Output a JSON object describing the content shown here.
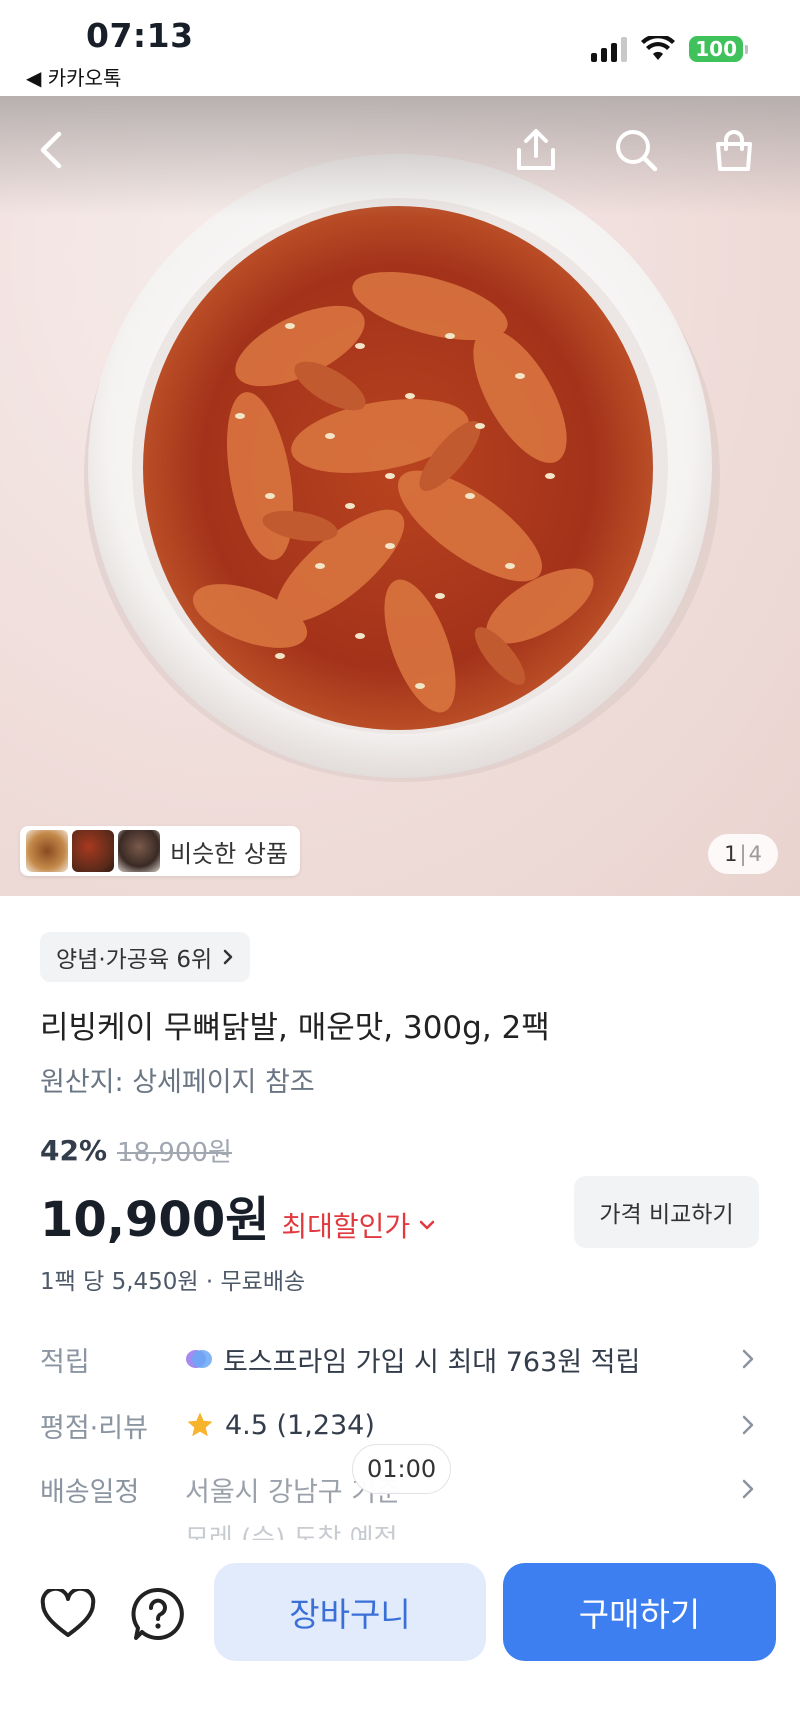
{
  "status": {
    "time": "07:13",
    "back_app": "◀ 카카오톡",
    "battery": "100"
  },
  "gallery": {
    "current": "1",
    "separator": "|",
    "total": "4",
    "similar_label": "비슷한 상품"
  },
  "product": {
    "rank_label": "양념·가공육 6위",
    "title": "리빙케이 무뼈닭발, 매운맛, 300g, 2팩",
    "origin": "원산지: 상세페이지 참조",
    "discount_pct": "42%",
    "original_price": "18,900원",
    "price": "10,900원",
    "max_discount_label": "최대할인가",
    "compare_label": "가격 비교하기",
    "per_pack": "1팩 당 5,450원 · 무료배송"
  },
  "info_rows": {
    "points": {
      "label": "적립",
      "value": "토스프라임 가입 시 최대 763원 적립"
    },
    "rating": {
      "label": "평점·리뷰",
      "value": "4.5 (1,234)"
    },
    "delivery": {
      "label": "배송일정",
      "value": "서울시 강남구 기준",
      "sub": "모레 (수) 도착 예정"
    }
  },
  "timer": "01:00",
  "bottom": {
    "cart_label": "장바구니",
    "buy_label": "구매하기"
  },
  "colors": {
    "primary": "#3d7ef0",
    "cart_bg": "#e1ebfc",
    "discount_red": "#e03a3e",
    "star": "#f7b32b",
    "battery": "#3fc25b"
  }
}
